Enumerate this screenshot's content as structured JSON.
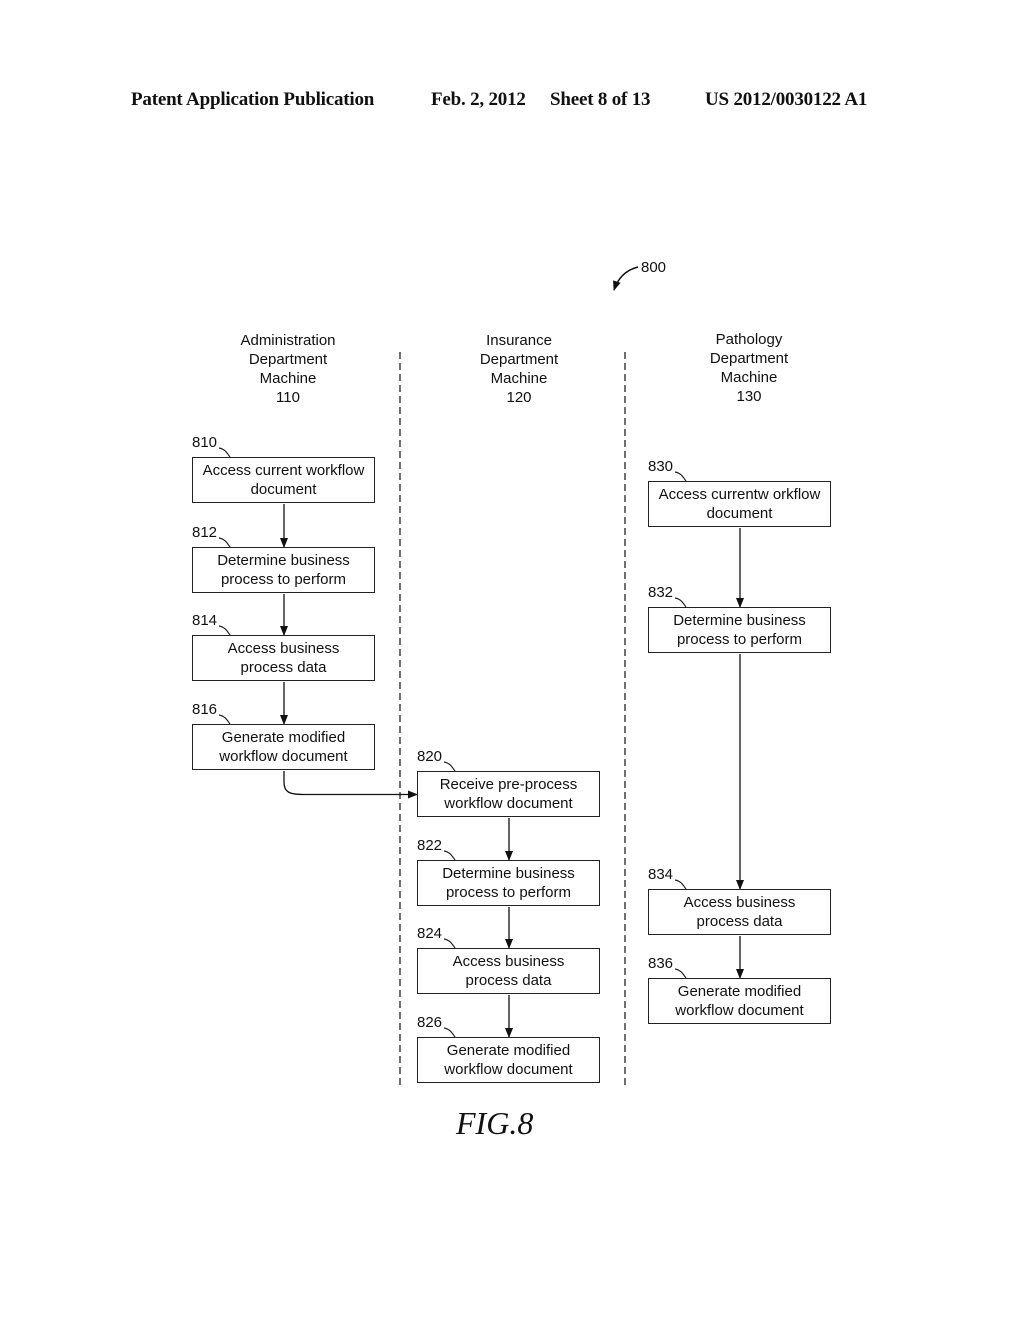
{
  "header": {
    "publication": "Patent Application Publication",
    "date": "Feb. 2, 2012",
    "sheet": "Sheet 8 of 13",
    "patent_number": "US 2012/0030122 A1"
  },
  "figure": {
    "reference": "800",
    "label": "FIG.8"
  },
  "lanes": [
    {
      "title_lines": [
        "Administration",
        "Department",
        "Machine",
        "110"
      ]
    },
    {
      "title_lines": [
        "Insurance",
        "Department",
        "Machine",
        "120"
      ]
    },
    {
      "title_lines": [
        "Pathology",
        "Department",
        "Machine",
        "130"
      ]
    }
  ],
  "steps": [
    {
      "id": "810",
      "lane": 0,
      "lines": [
        "Access current workflow",
        "document"
      ]
    },
    {
      "id": "812",
      "lane": 0,
      "lines": [
        "Determine business",
        "process to perform"
      ]
    },
    {
      "id": "814",
      "lane": 0,
      "lines": [
        "Access business",
        "process data"
      ]
    },
    {
      "id": "816",
      "lane": 0,
      "lines": [
        "Generate modified",
        "workflow document"
      ]
    },
    {
      "id": "820",
      "lane": 1,
      "lines": [
        "Receive pre-process",
        "workflow document"
      ]
    },
    {
      "id": "822",
      "lane": 1,
      "lines": [
        "Determine business",
        "process to perform"
      ]
    },
    {
      "id": "824",
      "lane": 1,
      "lines": [
        "Access business",
        "process data"
      ]
    },
    {
      "id": "826",
      "lane": 1,
      "lines": [
        "Generate modified",
        "workflow document"
      ]
    },
    {
      "id": "830",
      "lane": 2,
      "lines": [
        "Access currentw orkflow",
        "document"
      ]
    },
    {
      "id": "832",
      "lane": 2,
      "lines": [
        "Determine business",
        "process to perform"
      ]
    },
    {
      "id": "834",
      "lane": 2,
      "lines": [
        "Access business",
        "process data"
      ]
    },
    {
      "id": "836",
      "lane": 2,
      "lines": [
        "Generate modified",
        "workflow document"
      ]
    }
  ],
  "flows": [
    [
      "810",
      "812"
    ],
    [
      "812",
      "814"
    ],
    [
      "814",
      "816"
    ],
    [
      "816",
      "820"
    ],
    [
      "820",
      "822"
    ],
    [
      "822",
      "824"
    ],
    [
      "824",
      "826"
    ],
    [
      "830",
      "832"
    ],
    [
      "832",
      "834"
    ],
    [
      "834",
      "836"
    ]
  ]
}
